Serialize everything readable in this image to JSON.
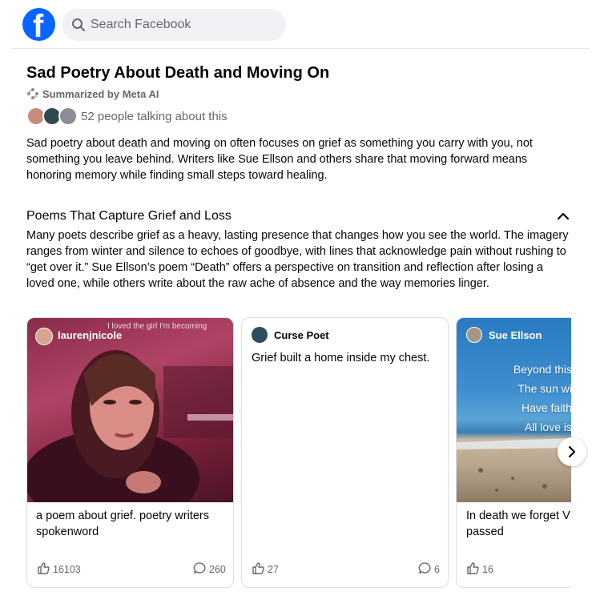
{
  "header": {
    "logo_letter": "f",
    "search_placeholder": "Search Facebook"
  },
  "topic": {
    "title": "Sad Poetry About Death and Moving On",
    "summarized_by": "Summarized by Meta AI",
    "talking_count": "52 people talking about this",
    "summary": "Sad poetry about death and moving on often focuses on grief as something you carry with you, not something you leave behind. Writers like Sue Ellson and others share that moving forward means honoring memory while finding small steps toward healing."
  },
  "section": {
    "title": "Poems That Capture Grief and Loss",
    "body": "Many poets describe grief as a heavy, lasting presence that changes how you see the world. The imagery ranges from winter and silence to echoes of goodbye, with lines that acknowledge pain without rushing to “get over it.” Sue Ellson’s poem “Death” offers a perspective on transition and reflection after losing a loved one, while others write about the raw ache of absence and the way memories linger."
  },
  "cards": [
    {
      "author": "laurenjnicole",
      "overlay_text": "I loved the girl I'm becoming",
      "caption": "a poem about grief. poetry writers spokenword",
      "likes": "16103",
      "comments": "260"
    },
    {
      "author": "Curse Poet",
      "poem": "Grief built a home inside my chest.",
      "likes": "27",
      "comments": "6"
    },
    {
      "author": "Sue Ellson",
      "image_lines": [
        "Beyond this",
        "The sun wi",
        "Have faith",
        "All love is"
      ],
      "caption": "In death we forget V",
      "caption_line2": "passed",
      "likes": "16"
    }
  ],
  "icons": {
    "logo": "facebook-logo",
    "search": "search-icon",
    "meta_ai": "sparkle-icon",
    "collapse": "chevron-up-icon",
    "like": "thumbs-up-icon",
    "comment": "comment-icon",
    "next": "chevron-right-icon"
  },
  "colors": {
    "brand": "#0866ff",
    "text_primary": "#050505",
    "text_secondary": "#65676b",
    "search_bg": "#f0f2f5"
  }
}
